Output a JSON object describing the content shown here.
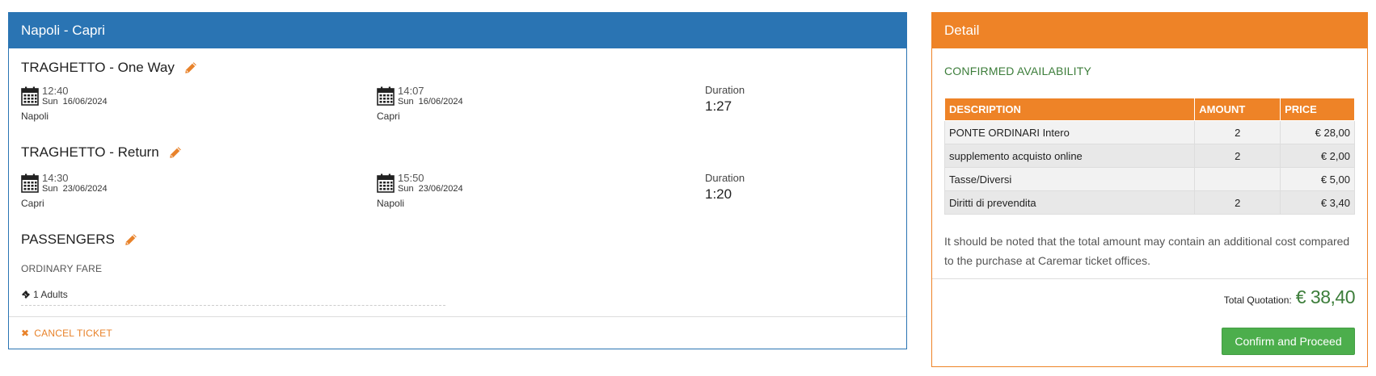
{
  "trip": {
    "header_title": "Napoli - Capri",
    "outbound": {
      "title": "TRAGHETTO - One Way",
      "departure": {
        "time": "12:40",
        "day": "Sun",
        "date": "16/06/2024",
        "port": "Napoli"
      },
      "arrival": {
        "time": "14:07",
        "day": "Sun",
        "date": "16/06/2024",
        "port": "Capri"
      },
      "duration_label": "Duration",
      "duration_value": "1:27"
    },
    "return": {
      "title": "TRAGHETTO - Return",
      "departure": {
        "time": "14:30",
        "day": "Sun",
        "date": "23/06/2024",
        "port": "Capri"
      },
      "arrival": {
        "time": "15:50",
        "day": "Sun",
        "date": "23/06/2024",
        "port": "Napoli"
      },
      "duration_label": "Duration",
      "duration_value": "1:20"
    },
    "passengers": {
      "title": "PASSENGERS",
      "fare": "ORDINARY FARE",
      "adults": "1 Adults"
    },
    "cancel_label": "CANCEL TICKET"
  },
  "detail": {
    "header_title": "Detail",
    "availability": "CONFIRMED AVAILABILITY",
    "table": {
      "headers": [
        "DESCRIPTION",
        "AMOUNT",
        "PRICE"
      ],
      "rows": [
        {
          "description": "PONTE ORDINARI Intero",
          "amount": "2",
          "price": "€ 28,00"
        },
        {
          "description": "supplemento acquisto online",
          "amount": "2",
          "price": "€ 2,00"
        },
        {
          "description": "Tasse/Diversi",
          "amount": "",
          "price": "€ 5,00"
        },
        {
          "description": "Diritti di prevendita",
          "amount": "2",
          "price": "€ 3,40"
        }
      ]
    },
    "note": "It should be noted that the total amount may contain an additional cost compared to the purchase at Caremar ticket offices.",
    "total_label": "Total Quotation:",
    "total_value": "€ 38,40",
    "confirm_label": "Confirm and Proceed"
  },
  "colors": {
    "blue": "#2a74b3",
    "orange": "#ee8327",
    "green_text": "#3c7d3a",
    "green_button": "#4cae4c"
  },
  "icons": [
    "calendar-icon",
    "pencil-icon",
    "ticket-icon",
    "close-icon"
  ]
}
